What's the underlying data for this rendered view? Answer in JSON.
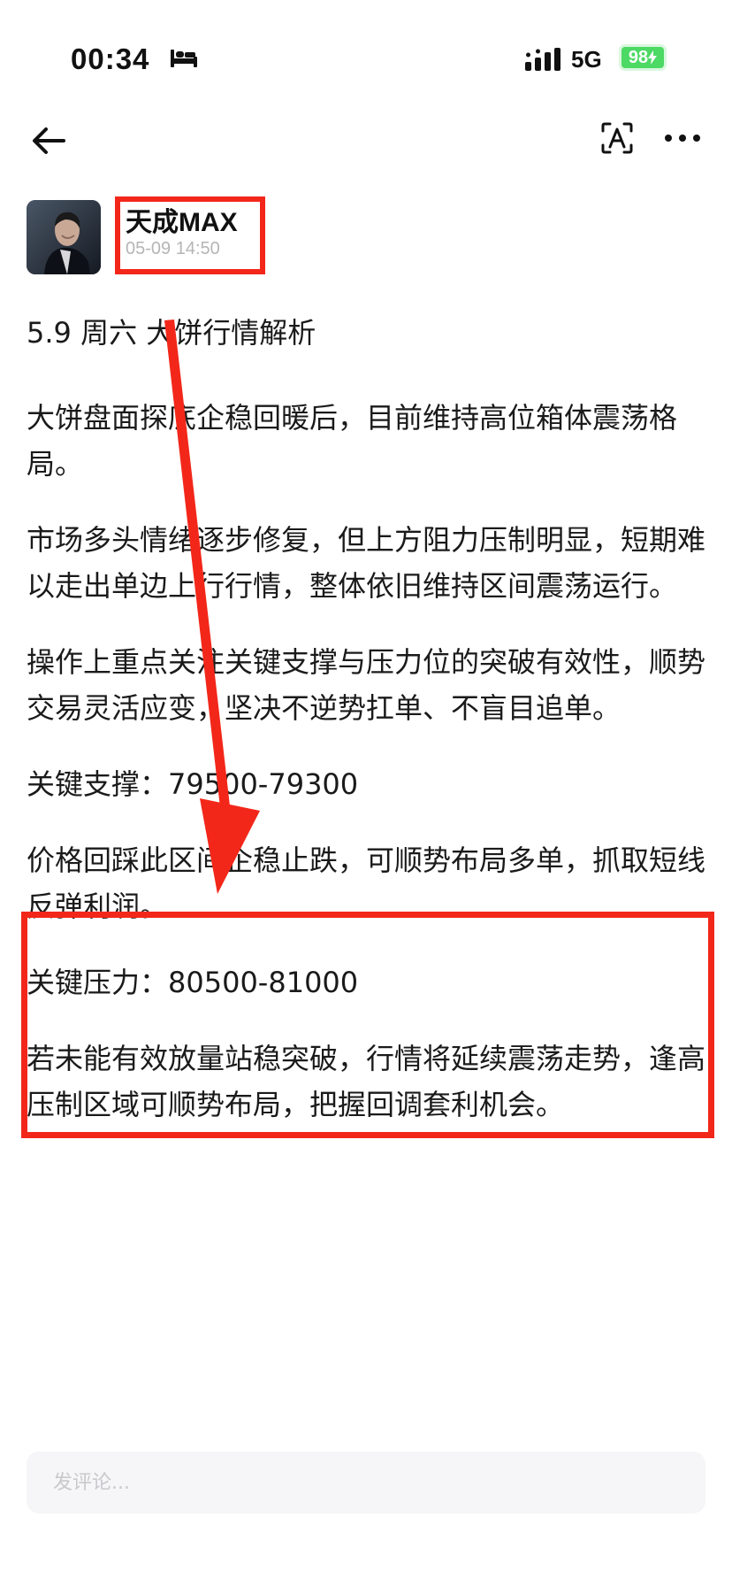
{
  "status_bar": {
    "time": "00:34",
    "network": "5G",
    "battery": "98",
    "icons": [
      "bed-icon",
      "signal-icon",
      "charging-bolt-icon"
    ]
  },
  "nav": {
    "icons": [
      "back-arrow-icon",
      "translate-icon",
      "more-icon"
    ]
  },
  "post": {
    "author": "天成MAX",
    "time": "05-09 14:50",
    "paragraphs": [
      "5.9 周六 大饼行情解析",
      "大饼盘面探底企稳回暖后，目前维持高位箱体震荡格局。",
      "市场多头情绪逐步修复，但上方阻力压制明显，短期难以走出单边上行行情，整体依旧维持区间震荡运行。",
      "操作上重点关注关键支撑与压力位的突破有效性，顺势交易灵活应变，坚决不逆势扛单、不盲目追单。",
      "关键支撑：79500-79300",
      "价格回踩此区间企稳止跌，可顺势布局多单，抓取短线反弹利润。",
      "关键压力：80500-81000",
      "若未能有效放量站稳突破，行情将延续震荡走势，逢高压制区域可顺势布局，把握回调套利机会。"
    ]
  },
  "comment": {
    "placeholder": "发评论..."
  },
  "colors": {
    "annotation_red": "#f2271a",
    "battery_green": "#4cd964",
    "placeholder_gray": "#c9c9cc"
  }
}
